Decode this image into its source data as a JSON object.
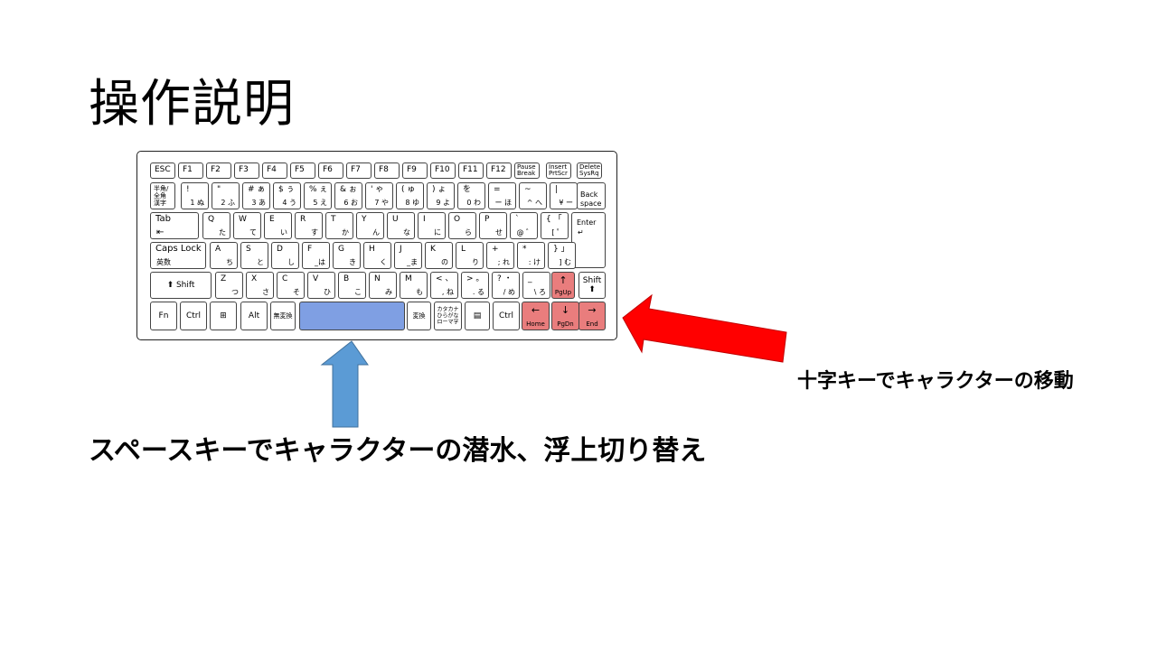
{
  "title": "操作説明",
  "captions": {
    "space": "スペースキーでキャラクターの潜水、浮上切り替え",
    "arrows": "十字キーでキャラクターの移動"
  },
  "colors": {
    "space_highlight": "#7f9fe3",
    "arrow_highlight": "#e97d7d",
    "up_arrow": "#5b9bd5",
    "left_arrow": "#ff0000"
  },
  "keyboard": {
    "fn_row": [
      "ESC",
      "F1",
      "F2",
      "F3",
      "F4",
      "F5",
      "F6",
      "F7",
      "F8",
      "F9",
      "F10",
      "F11",
      "F12",
      "Pause\nBreak",
      "Insert\nPrtScr",
      "Delete\nSysRq"
    ],
    "num_row": [
      {
        "t": "半角/\n全角\n漢字",
        "b": ""
      },
      {
        "t": "!",
        "b": "1 ぬ"
      },
      {
        "t": "\"",
        "b": "2 ふ"
      },
      {
        "t": "# ぁ",
        "b": "3 あ"
      },
      {
        "t": "$ ぅ",
        "b": "4 う"
      },
      {
        "t": "% ぇ",
        "b": "5 え"
      },
      {
        "t": "& ぉ",
        "b": "6 お"
      },
      {
        "t": "' ゃ",
        "b": "7 や"
      },
      {
        "t": "( ゅ",
        "b": "8 ゆ"
      },
      {
        "t": ") ょ",
        "b": "9 よ"
      },
      {
        "t": "を",
        "b": "0 わ"
      },
      {
        "t": "=",
        "b": "ー ほ"
      },
      {
        "t": "~",
        "b": "^ へ"
      },
      {
        "t": "|",
        "b": "¥ ー"
      },
      {
        "t": "Back\nspace",
        "b": ""
      }
    ],
    "q_row": [
      {
        "t": "Tab",
        "b": "⇤"
      },
      {
        "t": "Q",
        "b": "た"
      },
      {
        "t": "W",
        "b": "て"
      },
      {
        "t": "E",
        "b": "い"
      },
      {
        "t": "R",
        "b": "す"
      },
      {
        "t": "T",
        "b": "か"
      },
      {
        "t": "Y",
        "b": "ん"
      },
      {
        "t": "U",
        "b": "な"
      },
      {
        "t": "I",
        "b": "に"
      },
      {
        "t": "O",
        "b": "ら"
      },
      {
        "t": "P",
        "b": "せ"
      },
      {
        "t": "`",
        "b": "@ ゛"
      },
      {
        "t": "{ 「",
        "b": "[ ゜"
      },
      {
        "t": "Enter",
        "b": "↵"
      }
    ],
    "a_row": [
      {
        "t": "Caps Lock",
        "b": "英数"
      },
      {
        "t": "A",
        "b": "ち"
      },
      {
        "t": "S",
        "b": "と"
      },
      {
        "t": "D",
        "b": "し"
      },
      {
        "t": "F",
        "b": "_は"
      },
      {
        "t": "G",
        "b": "き"
      },
      {
        "t": "H",
        "b": "く"
      },
      {
        "t": "J",
        "b": "_ま"
      },
      {
        "t": "K",
        "b": "の"
      },
      {
        "t": "L",
        "b": "り"
      },
      {
        "t": "+",
        "b": "; れ"
      },
      {
        "t": "*",
        "b": ": け"
      },
      {
        "t": "} 」",
        "b": "] む"
      }
    ],
    "z_row": [
      {
        "t": "Shift",
        "b": ""
      },
      {
        "t": "Z",
        "b": "つ"
      },
      {
        "t": "X",
        "b": "さ"
      },
      {
        "t": "C",
        "b": "そ"
      },
      {
        "t": "V",
        "b": "ひ"
      },
      {
        "t": "B",
        "b": "こ"
      },
      {
        "t": "N",
        "b": "み"
      },
      {
        "t": "M",
        "b": "も"
      },
      {
        "t": "< 、",
        "b": ", ね"
      },
      {
        "t": "> 。",
        "b": ". る"
      },
      {
        "t": "? ・",
        "b": "/ め"
      },
      {
        "t": "_",
        "b": "\\ ろ"
      },
      {
        "t": "↑",
        "b": "PgUp"
      },
      {
        "t": "Shift",
        "b": ""
      }
    ],
    "bottom_row": {
      "fn": "Fn",
      "ctrl_left": "Ctrl",
      "win": "⊞",
      "alt": "Alt",
      "muhenkan": "無変換",
      "henkan": "変換",
      "kana": "カタカナ\nひらがな\nローマ字",
      "menu": "▤",
      "ctrl_right": "Ctrl",
      "left": {
        "arrow": "←",
        "label": "Home"
      },
      "down": {
        "arrow": "↓",
        "label": "PgDn"
      },
      "right": {
        "arrow": "→",
        "label": "End"
      }
    }
  }
}
